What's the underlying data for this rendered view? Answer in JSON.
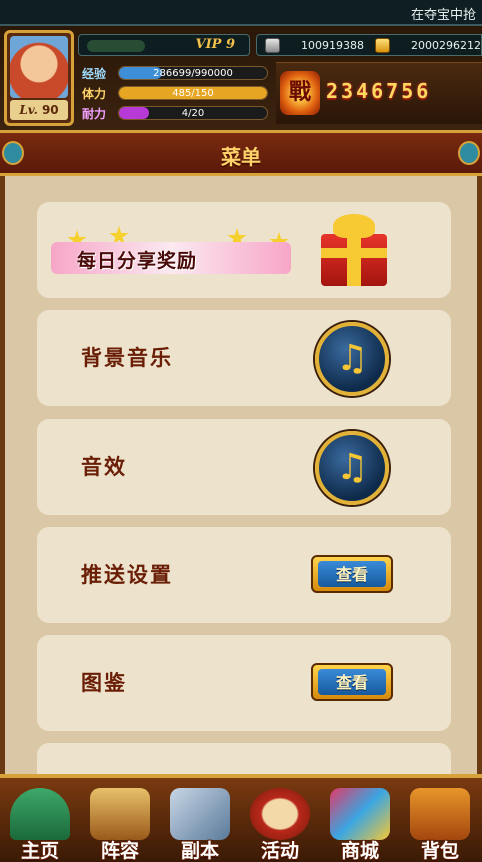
{
  "ticker": {
    "text": "在夺宝中抢"
  },
  "player": {
    "level_prefix": "Lv.",
    "level": "90",
    "vip": "VIP 9"
  },
  "currency": {
    "silver": "100919388",
    "gold": "2000296212"
  },
  "stats": [
    {
      "label": "经验",
      "text": "286699/990000",
      "fill": 0.29,
      "color": "#3f8fd8",
      "label_color": "#9fdcff"
    },
    {
      "label": "体力",
      "text": "485/150",
      "fill": 1.0,
      "color": "#e6a624",
      "label_color": "#ffd36a"
    },
    {
      "label": "耐力",
      "text": "4/20",
      "fill": 0.2,
      "color": "#b83ad6",
      "label_color": "#f2a0ff"
    }
  ],
  "power": {
    "badge": "戰",
    "value": "2346756"
  },
  "menu": {
    "title": "菜单",
    "daily_share": "每日分享奖励",
    "bg_music": "背景音乐",
    "sound_fx": "音效",
    "push_settings": "推送设置",
    "push_view": "查看",
    "codex": "图鉴",
    "codex_view": "查看",
    "music_note": "♫"
  },
  "nav": [
    {
      "label": "主页",
      "icon": "home-icon"
    },
    {
      "label": "阵容",
      "icon": "lineup-icon"
    },
    {
      "label": "副本",
      "icon": "swords-icon"
    },
    {
      "label": "活动",
      "icon": "drum-icon"
    },
    {
      "label": "商城",
      "icon": "gems-icon"
    },
    {
      "label": "背包",
      "icon": "chest-icon"
    }
  ]
}
